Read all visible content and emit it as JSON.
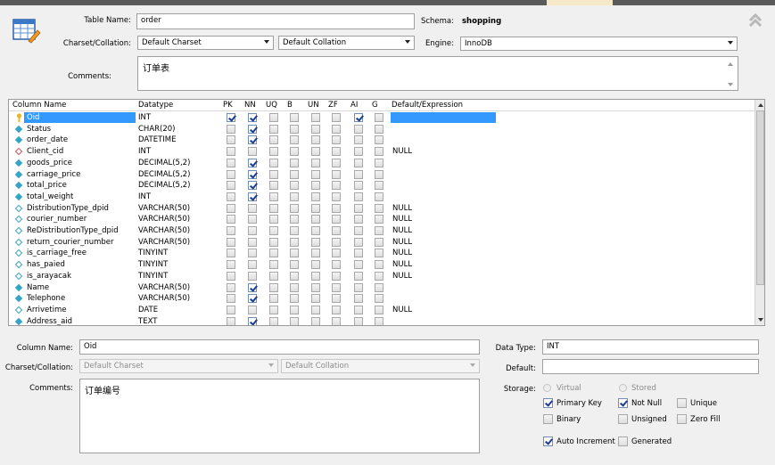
{
  "table": {
    "name_label": "Table Name:",
    "name_value": "order",
    "schema_label": "Schema:",
    "schema_value": "shopping",
    "charset_label": "Charset/Collation:",
    "charset_value": "Default Charset",
    "collation_value": "Default Collation",
    "engine_label": "Engine:",
    "engine_value": "InnoDB",
    "comments_label": "Comments:",
    "comments_value": "订单表"
  },
  "grid": {
    "headers": [
      "Column Name",
      "Datatype",
      "PK",
      "NN",
      "UQ",
      "B",
      "UN",
      "ZF",
      "AI",
      "G",
      "Default/Expression"
    ],
    "rows": [
      {
        "name": "Oid",
        "type": "INT",
        "icon": "key",
        "flags": [
          1,
          1,
          0,
          0,
          0,
          0,
          1,
          0
        ],
        "default": "",
        "selected": true
      },
      {
        "name": "Status",
        "type": "CHAR(20)",
        "icon": "blue",
        "flags": [
          0,
          1,
          0,
          0,
          0,
          0,
          0,
          0
        ],
        "default": ""
      },
      {
        "name": "order_date",
        "type": "DATETIME",
        "icon": "blue",
        "flags": [
          0,
          1,
          0,
          0,
          0,
          0,
          0,
          0
        ],
        "default": ""
      },
      {
        "name": "Client_cid",
        "type": "INT",
        "icon": "red",
        "flags": [
          0,
          0,
          0,
          0,
          0,
          0,
          0,
          0
        ],
        "default": "NULL"
      },
      {
        "name": "goods_price",
        "type": "DECIMAL(5,2)",
        "icon": "blue",
        "flags": [
          0,
          1,
          0,
          0,
          0,
          0,
          0,
          0
        ],
        "default": ""
      },
      {
        "name": "carriage_price",
        "type": "DECIMAL(5,2)",
        "icon": "blue",
        "flags": [
          0,
          1,
          0,
          0,
          0,
          0,
          0,
          0
        ],
        "default": ""
      },
      {
        "name": "total_price",
        "type": "DECIMAL(5,2)",
        "icon": "blue",
        "flags": [
          0,
          1,
          0,
          0,
          0,
          0,
          0,
          0
        ],
        "default": ""
      },
      {
        "name": "total_weight",
        "type": "INT",
        "icon": "blue",
        "flags": [
          0,
          1,
          0,
          0,
          0,
          0,
          0,
          0
        ],
        "default": ""
      },
      {
        "name": "DistributionType_dpid",
        "type": "VARCHAR(50)",
        "icon": "white",
        "flags": [
          0,
          0,
          0,
          0,
          0,
          0,
          0,
          0
        ],
        "default": "NULL"
      },
      {
        "name": "courier_number",
        "type": "VARCHAR(50)",
        "icon": "white",
        "flags": [
          0,
          0,
          0,
          0,
          0,
          0,
          0,
          0
        ],
        "default": "NULL"
      },
      {
        "name": "ReDistributionType_dpid",
        "type": "VARCHAR(50)",
        "icon": "white",
        "flags": [
          0,
          0,
          0,
          0,
          0,
          0,
          0,
          0
        ],
        "default": "NULL"
      },
      {
        "name": "return_courier_number",
        "type": "VARCHAR(50)",
        "icon": "white",
        "flags": [
          0,
          0,
          0,
          0,
          0,
          0,
          0,
          0
        ],
        "default": "NULL"
      },
      {
        "name": "is_carriage_free",
        "type": "TINYINT",
        "icon": "white",
        "flags": [
          0,
          0,
          0,
          0,
          0,
          0,
          0,
          0
        ],
        "default": "NULL"
      },
      {
        "name": "has_paied",
        "type": "TINYINT",
        "icon": "white",
        "flags": [
          0,
          0,
          0,
          0,
          0,
          0,
          0,
          0
        ],
        "default": "NULL"
      },
      {
        "name": "is_arayacak",
        "type": "TINYINT",
        "icon": "white",
        "flags": [
          0,
          0,
          0,
          0,
          0,
          0,
          0,
          0
        ],
        "default": "NULL"
      },
      {
        "name": "Name",
        "type": "VARCHAR(50)",
        "icon": "blue",
        "flags": [
          0,
          1,
          0,
          0,
          0,
          0,
          0,
          0
        ],
        "default": ""
      },
      {
        "name": "Telephone",
        "type": "VARCHAR(50)",
        "icon": "blue",
        "flags": [
          0,
          1,
          0,
          0,
          0,
          0,
          0,
          0
        ],
        "default": ""
      },
      {
        "name": "Arrivetime",
        "type": "DATE",
        "icon": "white",
        "flags": [
          0,
          0,
          0,
          0,
          0,
          0,
          0,
          0
        ],
        "default": "NULL"
      },
      {
        "name": "Address_aid",
        "type": "TEXT",
        "icon": "blue",
        "flags": [
          0,
          1,
          0,
          0,
          0,
          0,
          0,
          0
        ],
        "default": ""
      }
    ]
  },
  "column": {
    "name_label": "Column Name:",
    "name_value": "Oid",
    "charset_label": "Charset/Collation:",
    "charset_value": "Default Charset",
    "collation_value": "Default Collation",
    "comments_label": "Comments:",
    "comments_value": "订单编号",
    "datatype_label": "Data Type:",
    "datatype_value": "INT",
    "default_label": "Default:",
    "default_value": "",
    "storage_label": "Storage:",
    "virtual_label": "Virtual",
    "stored_label": "Stored",
    "primary_key_label": "Primary Key",
    "primary_key": true,
    "not_null_label": "Not Null",
    "not_null": true,
    "unique_label": "Unique",
    "unique": false,
    "binary_label": "Binary",
    "binary": false,
    "unsigned_label": "Unsigned",
    "unsigned": false,
    "zero_fill_label": "Zero Fill",
    "zero_fill": false,
    "auto_increment_label": "Auto Increment",
    "auto_increment": true,
    "generated_label": "Generated",
    "generated": false
  },
  "colors": {
    "selection": "#3399ff",
    "blue_icon": "#35a4c8",
    "red_icon": "#d05050",
    "key_icon": "#e8b820"
  }
}
